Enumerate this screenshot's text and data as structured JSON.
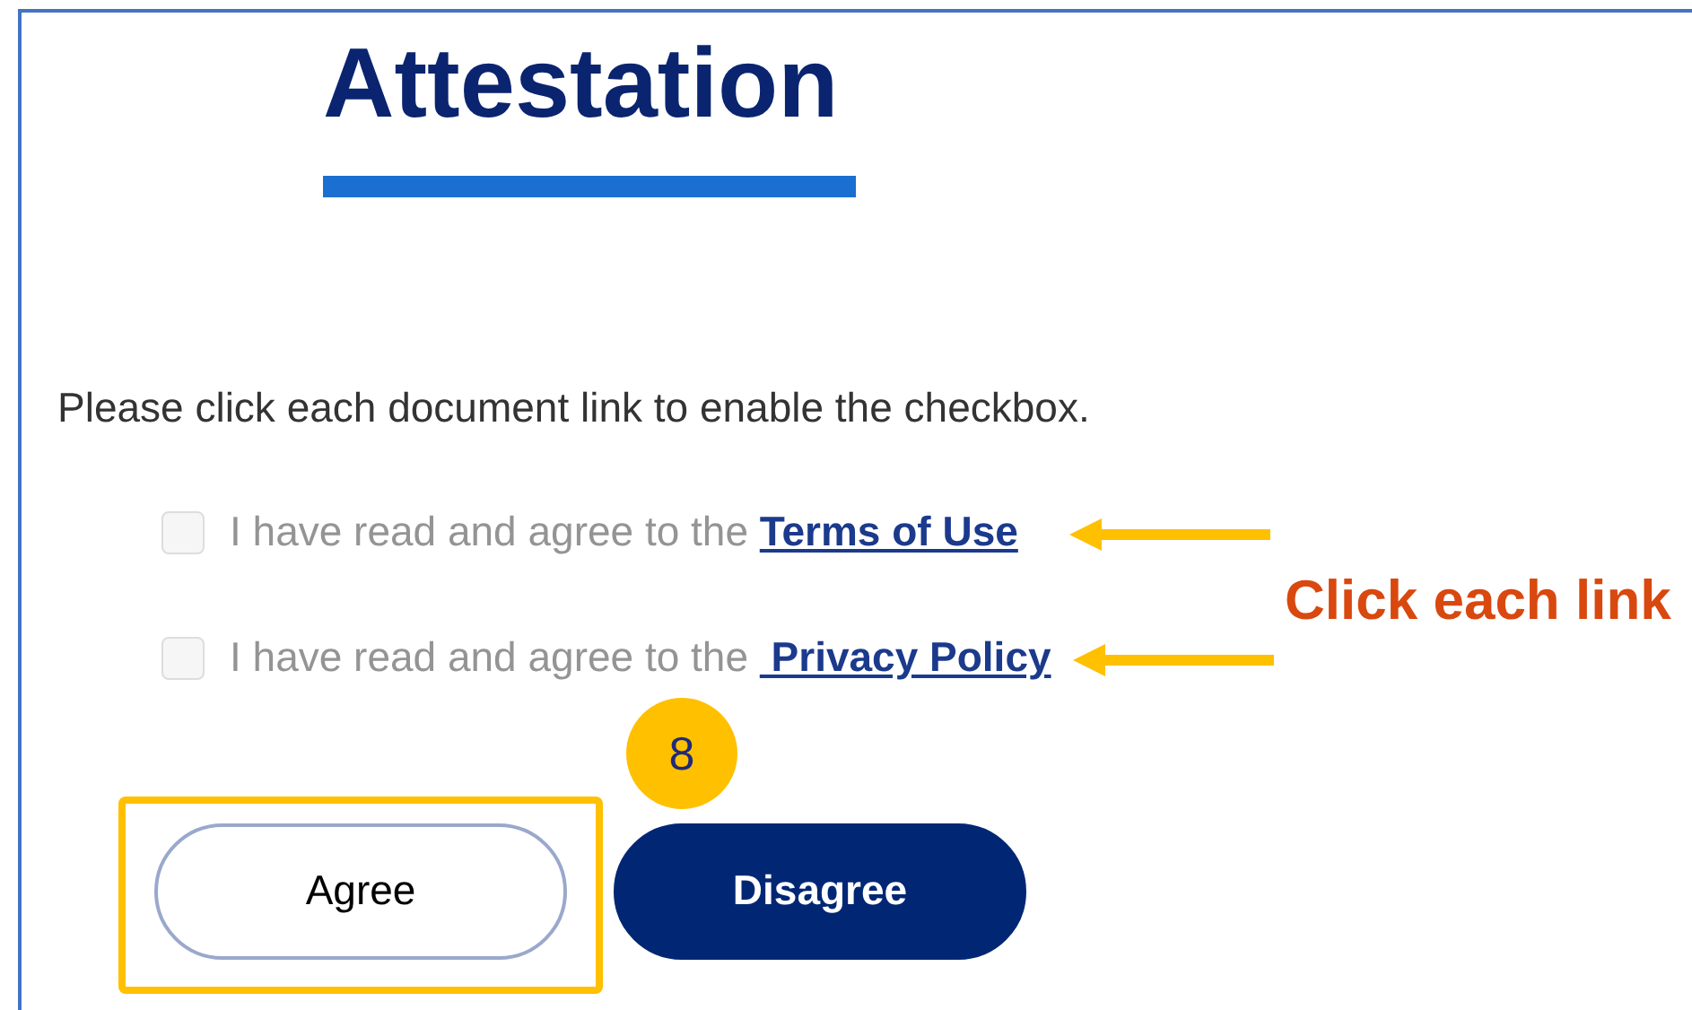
{
  "title": "Attestation",
  "instruction": "Please click each document link to enable the checkbox.",
  "agreements": [
    {
      "text": "I have read and agree to the",
      "link": "Terms of Use",
      "checked": false,
      "disabled": true
    },
    {
      "text": "I have read and agree to the",
      "link": " Privacy Policy",
      "checked": false,
      "disabled": true
    }
  ],
  "buttons": [
    {
      "label": "Agree",
      "kind": "secondary"
    },
    {
      "label": "Disagree",
      "kind": "primary"
    }
  ],
  "annotations": {
    "callout": "Click each link",
    "step_badge": "8"
  }
}
